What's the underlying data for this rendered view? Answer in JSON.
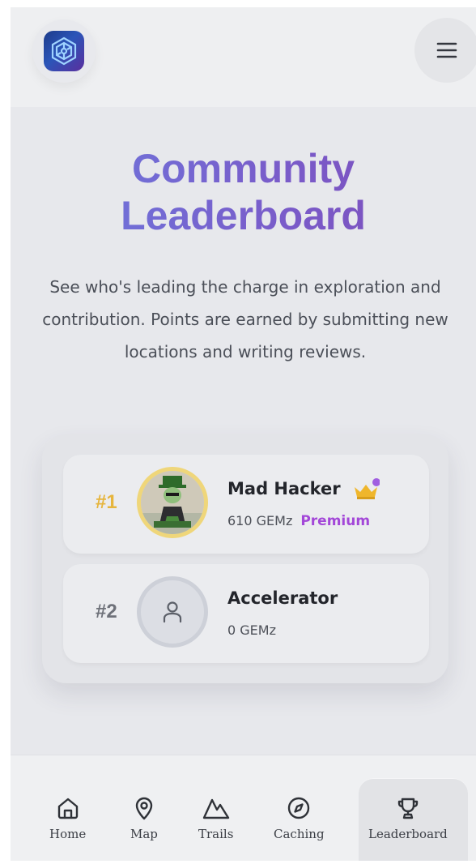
{
  "header": {
    "logo_icon": "maze-logo-icon",
    "menu_icon": "hamburger-menu-icon"
  },
  "hero": {
    "title_line1": "Community",
    "title_line2": "Leaderboard",
    "description": "See who's leading the charge in exploration and contribution. Points are earned by submitting new locations and writing reviews."
  },
  "leaderboard": {
    "entries": [
      {
        "rank": "#1",
        "name": "Mad Hacker",
        "points": "610 GEMz",
        "badge": "Premium",
        "avatar_icon": "user-avatar-image",
        "crown_icon": "crown-icon"
      },
      {
        "rank": "#2",
        "name": "Accelerator",
        "points": "0 GEMz",
        "avatar_icon": "user-placeholder-icon"
      }
    ]
  },
  "nav": {
    "items": [
      {
        "label": "Home",
        "icon": "home-icon"
      },
      {
        "label": "Map",
        "icon": "map-pin-icon"
      },
      {
        "label": "Trails",
        "icon": "mountain-icon"
      },
      {
        "label": "Caching",
        "icon": "compass-icon"
      },
      {
        "label": "Leaderboard",
        "icon": "trophy-icon",
        "active": true
      }
    ]
  },
  "colors": {
    "title_gradient_start": "#6c7bdf",
    "title_gradient_end": "#7e4bb8",
    "rank_gold": "#e6b53d",
    "premium": "#a347d8"
  }
}
